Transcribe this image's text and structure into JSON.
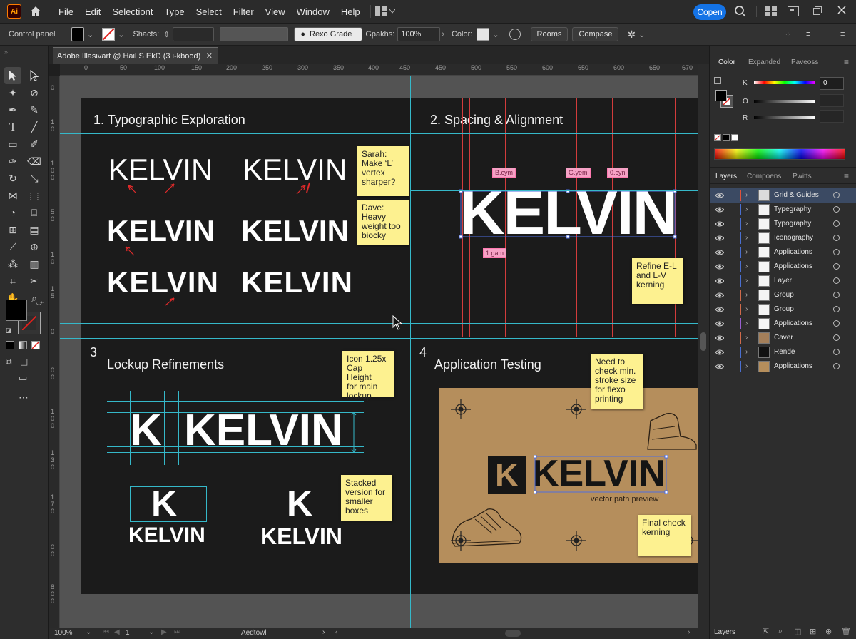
{
  "app": {
    "logo": "Ai",
    "menus": [
      "File",
      "Edit",
      "Selectiont",
      "Type",
      "Select",
      "Filter",
      "View",
      "Window",
      "Help"
    ],
    "open_button": "Copen"
  },
  "control": {
    "panel_label": "Control panel",
    "shacts_label": "Shacts:",
    "font_name": "Rexo Grade",
    "gpakhs_label": "Gpakhs:",
    "gpakhs_value": "100%",
    "color_label": "Color:",
    "rooms_button": "Rooms",
    "compase_button": "Compase"
  },
  "document": {
    "tab_title": "Adobe Illasivart @ Hail S EkD (3 i-kbood)",
    "zoom": "100%",
    "artboard_num": "1",
    "status_text": "Aedtowl"
  },
  "rulers": {
    "top": [
      "0",
      "50",
      "100",
      "150",
      "200",
      "250",
      "300",
      "350",
      "400",
      "450",
      "450",
      "500",
      "550",
      "600",
      "650",
      "600",
      "650",
      "670"
    ],
    "left": [
      "0",
      "1",
      "0",
      "1",
      "0",
      "0",
      "5",
      "0",
      "1",
      "0",
      "1",
      "5",
      "0",
      "0",
      "0",
      "1",
      "0",
      "0",
      "1",
      "3",
      "0",
      "1",
      "7",
      "0",
      "0",
      "0",
      "8",
      "0",
      "0"
    ]
  },
  "quadrants": {
    "q1": {
      "title": "1.  Typographic Exploration"
    },
    "q2": {
      "title": "2.  Spacing & Alignment"
    },
    "q3": {
      "num": "3",
      "title": "Lockup Refinements"
    },
    "q4": {
      "num": "4",
      "title": "Application Testing"
    }
  },
  "wordmark": "KELVIN",
  "monogram": "K",
  "notes": {
    "sarah": "Sarah:\nMake ‘L’\nvertex\nsharper?",
    "dave": "Dave:\nHeavy\nweight too\nbiocky",
    "kerning": "Refine E-L\nand L-V\nkerning",
    "icon": "Icon 1.25x\nCap Height\nfor main\nlockup",
    "stacked": "Stacked\nversion for\nsmaller\nboxes",
    "stroke": "Need to\ncheck min.\nstroke size\nfor flexo\nprinting",
    "final": "Final check\nkerning"
  },
  "spacing_tags": [
    "B.cym",
    "G.yem",
    "0.cyn",
    "1.gam"
  ],
  "vector_caption": "vector path preview",
  "panels": {
    "color_tabs": [
      "Color",
      "Expanded",
      "Paveoss"
    ],
    "k_value": "0",
    "row_labels": [
      "K",
      "O",
      "R"
    ],
    "layers_tabs": [
      "Layers",
      "Compoens",
      "Pwitts"
    ],
    "footer_label": "Layers",
    "layers": [
      {
        "name": "Grid & Guides",
        "color": "#e0513a"
      },
      {
        "name": "Typegraphy",
        "color": "#4a6fd0"
      },
      {
        "name": "Typography",
        "color": "#4a6fd0"
      },
      {
        "name": "Iconography",
        "color": "#4a6fd0"
      },
      {
        "name": "Applications",
        "color": "#4a6fd0"
      },
      {
        "name": "Applications",
        "color": "#4a6fd0"
      },
      {
        "name": "Layer",
        "color": "#4a6fd0"
      },
      {
        "name": "Group",
        "color": "#d06a4a"
      },
      {
        "name": "Group",
        "color": "#d06a4a"
      },
      {
        "name": "Applications",
        "color": "#9a5fd0"
      },
      {
        "name": "Caver",
        "color": "#d06a4a"
      },
      {
        "name": "Rende",
        "color": "#4a6fd0"
      },
      {
        "name": "Applications",
        "color": "#4a6fd0"
      }
    ]
  }
}
